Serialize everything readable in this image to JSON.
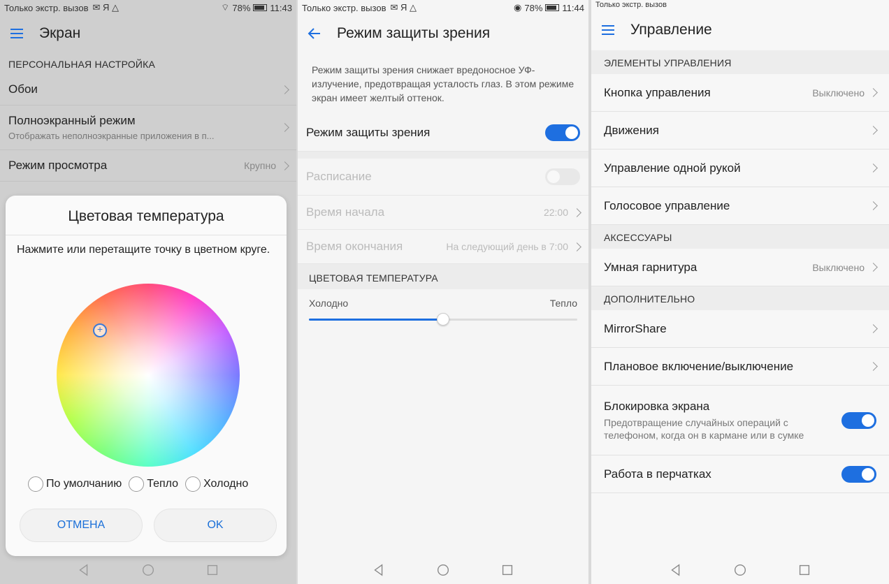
{
  "colors": {
    "accent": "#1e6fe0",
    "dim_bg": "#cfcfcf"
  },
  "panel1": {
    "status": {
      "left": "Только экстр. вызов",
      "right": "78%",
      "time": "11:43"
    },
    "title": "Экран",
    "section": "ПЕРСОНАЛЬНАЯ НАСТРОЙКА",
    "rows": [
      {
        "title": "Обои",
        "sub": "",
        "value": ""
      },
      {
        "title": "Полноэкранный режим",
        "sub": "Отображать неполноэкранные приложения в п...",
        "value": ""
      },
      {
        "title": "Режим просмотра",
        "sub": "",
        "value": "Крупно"
      }
    ],
    "dialog": {
      "title": "Цветовая температура",
      "message": "Нажмите или перетащите точку в цветном круге.",
      "options": [
        "По умолчанию",
        "Тепло",
        "Холодно"
      ],
      "cancel": "ОТМЕНА",
      "ok": "OK"
    }
  },
  "panel2": {
    "status": {
      "left": "Только экстр. вызов",
      "right": "78%",
      "time": "11:44"
    },
    "title": "Режим защиты зрения",
    "description": "Режим защиты зрения снижает вредоносное УФ-излучение, предотвращая усталость глаз. В этом режиме экран имеет желтый оттенок.",
    "main_toggle": {
      "label": "Режим защиты зрения",
      "on": true
    },
    "schedule": {
      "label": "Расписание",
      "on": false
    },
    "start": {
      "label": "Время начала",
      "value": "22:00"
    },
    "end": {
      "label": "Время окончания",
      "value": "На следующий день в 7:00"
    },
    "temp_section": "ЦВЕТОВАЯ ТЕМПЕРАТУРА",
    "slider": {
      "left": "Холодно",
      "right": "Тепло",
      "value": 0.5
    }
  },
  "panel3": {
    "status": {
      "left": "Только экстр. вызов"
    },
    "title": "Управление",
    "sections": {
      "controls": "ЭЛЕМЕНТЫ УПРАВЛЕНИЯ",
      "accessories": "АКСЕССУАРЫ",
      "extra": "ДОПОЛНИТЕЛЬНО"
    },
    "rows": {
      "button": {
        "title": "Кнопка управления",
        "value": "Выключено"
      },
      "motions": {
        "title": "Движения"
      },
      "one_hand": {
        "title": "Управление одной рукой"
      },
      "voice": {
        "title": "Голосовое управление"
      },
      "headset": {
        "title": "Умная гарнитура",
        "value": "Выключено"
      },
      "mirror": {
        "title": "MirrorShare"
      },
      "schedule": {
        "title": "Плановое включение/выключение"
      },
      "lock": {
        "title": "Блокировка экрана",
        "sub": "Предотвращение случайных операций с телефоном, когда он в кармане или в сумке",
        "on": true
      },
      "gloves": {
        "title": "Работа в перчатках",
        "on": true
      }
    }
  }
}
